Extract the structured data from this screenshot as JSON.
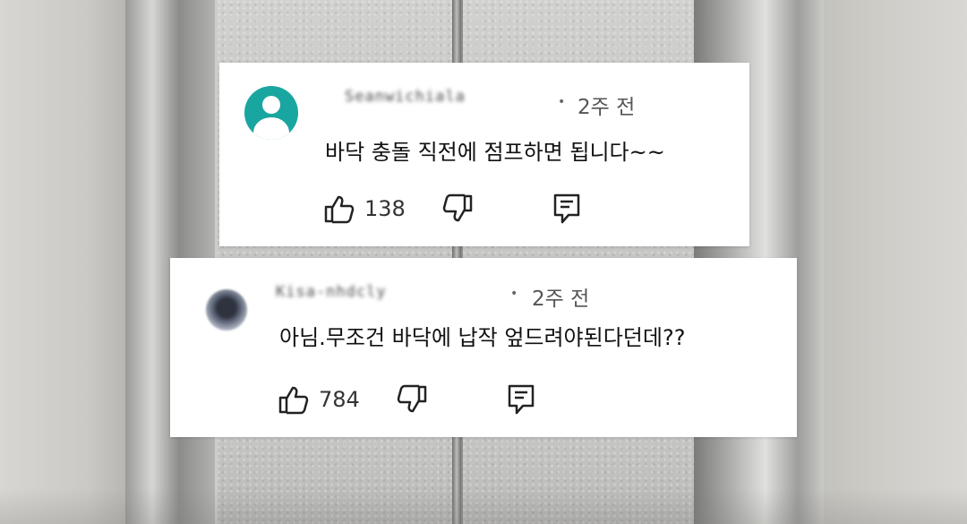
{
  "comments": [
    {
      "username": "Seanwichiala",
      "time": "2주 전",
      "text": "바닥 충돌 직전에 점프하면 됩니다~~",
      "likes": "138",
      "icons": {
        "avatar": "default-avatar-icon",
        "like": "thumbs-up-icon",
        "dislike": "thumbs-down-icon",
        "reply": "reply-icon"
      },
      "avatar_color": "#1aa6a0"
    },
    {
      "username": "Kisa-nhdcly",
      "time": "2주 전",
      "text": "아님.무조건 바닥에 납작 엎드려야된다던데??",
      "likes": "784",
      "icons": {
        "avatar": "profile-photo-avatar",
        "like": "thumbs-up-icon",
        "dislike": "thumbs-down-icon",
        "reply": "reply-icon"
      }
    }
  ]
}
